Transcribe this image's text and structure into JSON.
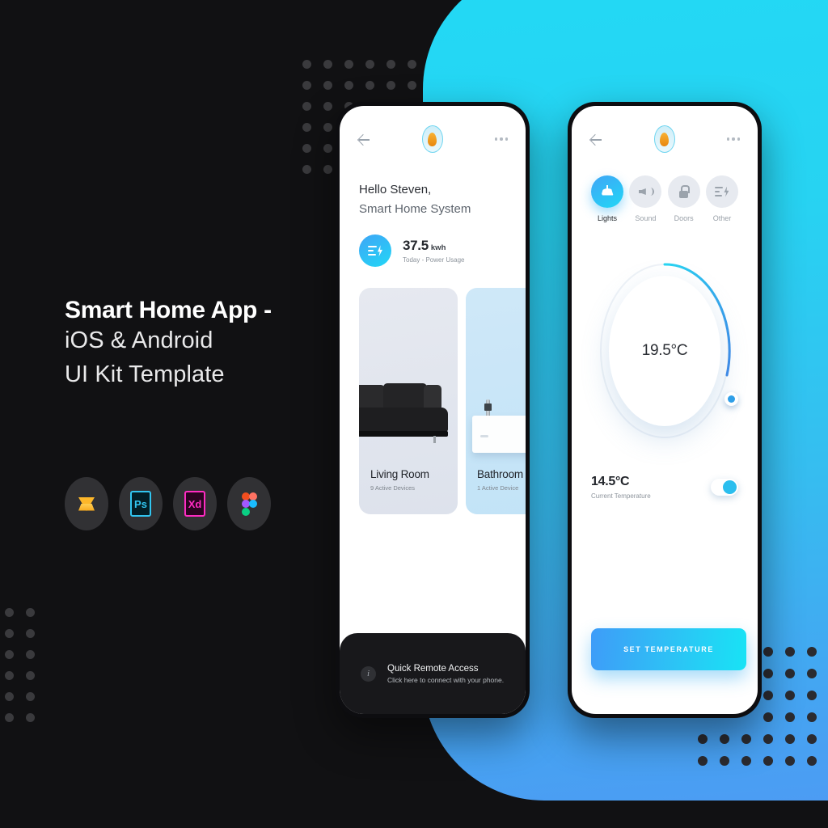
{
  "theme": {
    "background_dark": "#111113",
    "accent_cyan": "#22D9F5",
    "accent_blue": "#3FA5F6"
  },
  "promo": {
    "headline_line1": "Smart Home App -",
    "headline_line2": "iOS & Android",
    "headline_line3": "UI Kit Template",
    "tools": [
      {
        "name": "sketch-badge",
        "label": ""
      },
      {
        "name": "photoshop-badge",
        "label": "Ps"
      },
      {
        "name": "adobe-xd-badge",
        "label": "Xd"
      },
      {
        "name": "figma-badge",
        "label": ""
      }
    ]
  },
  "phone_home": {
    "header": {
      "back_icon": "back-arrow-icon",
      "logo_icon": "flame-bulb-logo-icon",
      "menu_icon": "more-options-icon"
    },
    "greeting_line1": "Hello Steven,",
    "greeting_line2": "Smart Home System",
    "usage": {
      "icon": "power-bolt-icon",
      "value": "37.5",
      "unit": "kwh",
      "caption": "Today - Power Usage"
    },
    "rooms": [
      {
        "name": "Living Room",
        "devices": "9 Active Devices",
        "image": "sofa-photo"
      },
      {
        "name": "Bathroom",
        "devices": "1 Active Device",
        "image": "sink-photo"
      }
    ],
    "banner": {
      "icon": "info-icon",
      "title": "Quick Remote Access",
      "subtitle": "Click here to connect with your phone."
    }
  },
  "phone_climate": {
    "header": {
      "back_icon": "back-arrow-icon",
      "logo_icon": "flame-bulb-logo-icon",
      "menu_icon": "more-options-icon"
    },
    "tabs": [
      {
        "label": "Lights",
        "icon": "lamp-icon",
        "active": true
      },
      {
        "label": "Sound",
        "icon": "speaker-icon",
        "active": false
      },
      {
        "label": "Doors",
        "icon": "lock-icon",
        "active": false
      },
      {
        "label": "Other",
        "icon": "sliders-bolt-icon",
        "active": false
      }
    ],
    "dial": {
      "target_temperature": "19.5°C",
      "arc_percent": 42
    },
    "current": {
      "value": "14.5°C",
      "caption": "Current Temperature",
      "toggle_state": "on"
    },
    "set_button": "SET TEMPERATURE"
  }
}
